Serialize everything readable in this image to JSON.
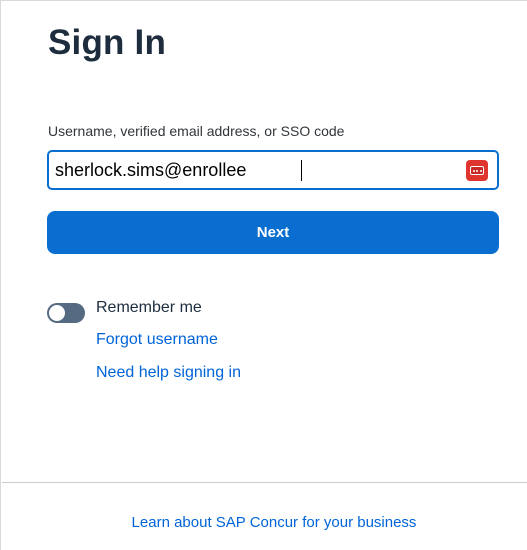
{
  "page": {
    "title": "Sign In"
  },
  "login_form": {
    "username_label": "Username, verified email address, or SSO code",
    "username_value": "sherlock.sims@enrollee",
    "password_manager_icon": "password-manager-icon",
    "next_label": "Next"
  },
  "options": {
    "remember_me_label": "Remember me",
    "remember_me_enabled": false,
    "forgot_username_label": "Forgot username",
    "help_label": "Need help signing in"
  },
  "footer": {
    "link_label": "Learn about SAP Concur for your business"
  },
  "colors": {
    "accent": "#0a6ed1",
    "link": "#0064d9",
    "toggle_off": "#556b82",
    "password_manager": "#e0342f"
  }
}
